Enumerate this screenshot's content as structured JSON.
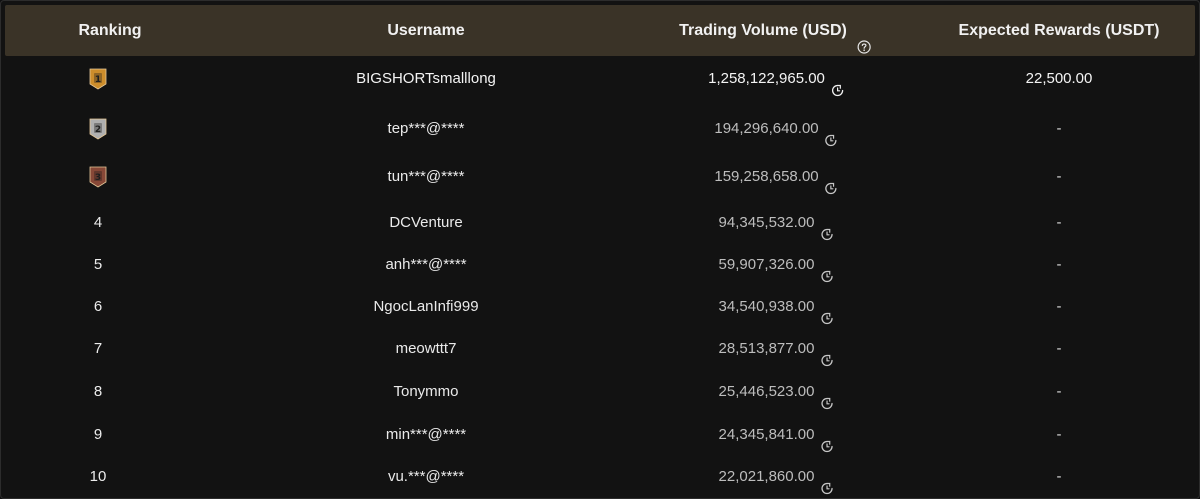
{
  "columns": {
    "ranking": "Ranking",
    "username": "Username",
    "volume": "Trading Volume (USD)",
    "rewards": "Expected Rewards (USDT)"
  },
  "icons": {
    "help": "question-circle-icon",
    "volume": "clock-refresh-icon",
    "medal_gold": "gold-medal-icon",
    "medal_silver": "silver-medal-icon",
    "medal_bronze": "bronze-medal-icon"
  },
  "colors": {
    "header_bg": "#3a3327",
    "gold": "#d9952e",
    "silver": "#b9b9b9",
    "bronze": "#8e4b3a"
  },
  "rows": [
    {
      "rank": "1",
      "medal": "gold",
      "username": "BIGSHORTsmalllong",
      "volume": "1,258,122,965.00",
      "reward": "22,500.00"
    },
    {
      "rank": "2",
      "medal": "silver",
      "username": "tep***@****",
      "volume": "194,296,640.00",
      "reward": "-"
    },
    {
      "rank": "3",
      "medal": "bronze",
      "username": "tun***@****",
      "volume": "159,258,658.00",
      "reward": "-"
    },
    {
      "rank": "4",
      "username": "DCVenture",
      "volume": "94,345,532.00",
      "reward": "-"
    },
    {
      "rank": "5",
      "username": "anh***@****",
      "volume": "59,907,326.00",
      "reward": "-"
    },
    {
      "rank": "6",
      "username": "NgocLanInfi999",
      "volume": "34,540,938.00",
      "reward": "-"
    },
    {
      "rank": "7",
      "username": "meowttt7",
      "volume": "28,513,877.00",
      "reward": "-"
    },
    {
      "rank": "8",
      "username": "Tonymmo",
      "volume": "25,446,523.00",
      "reward": "-"
    },
    {
      "rank": "9",
      "username": "min***@****",
      "volume": "24,345,841.00",
      "reward": "-"
    },
    {
      "rank": "10",
      "username": "vu.***@****",
      "volume": "22,021,860.00",
      "reward": "-"
    }
  ]
}
